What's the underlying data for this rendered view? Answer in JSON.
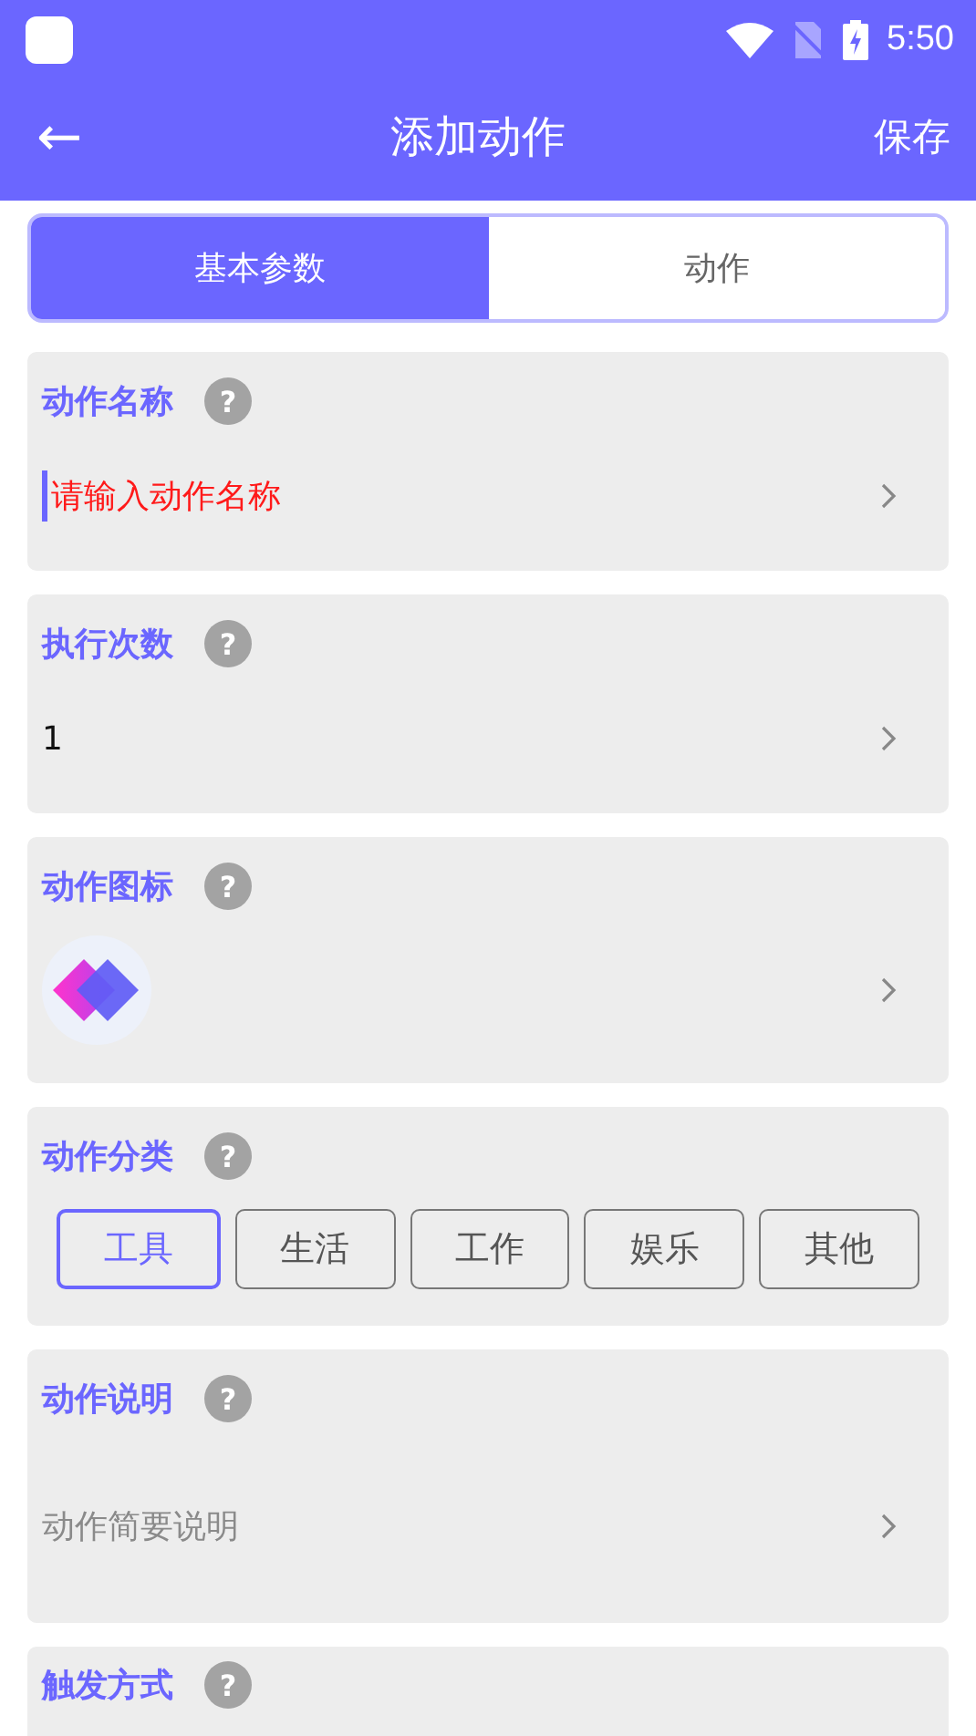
{
  "status_bar": {
    "time": "5:50"
  },
  "app_bar": {
    "back": "←",
    "title": "添加动作",
    "action": "保存"
  },
  "tabs": [
    {
      "label": "基本参数",
      "selected": true
    },
    {
      "label": "动作",
      "selected": false
    }
  ],
  "sections": [
    {
      "kind": "input",
      "title": "动作名称",
      "help": "?",
      "placeholder": "请输入动作名称",
      "focused": true
    },
    {
      "kind": "value",
      "title": "执行次数",
      "help": "?",
      "value": "1"
    },
    {
      "kind": "icon",
      "title": "动作图标",
      "help": "?"
    },
    {
      "kind": "chips",
      "title": "动作分类",
      "help": "?",
      "options": [
        {
          "label": "工具",
          "selected": true
        },
        {
          "label": "生活",
          "selected": false
        },
        {
          "label": "工作",
          "selected": false
        },
        {
          "label": "娱乐",
          "selected": false
        },
        {
          "label": "其他",
          "selected": false
        }
      ]
    },
    {
      "kind": "description",
      "title": "动作说明",
      "help": "?",
      "placeholder": "动作简要说明"
    },
    {
      "kind": "trigger",
      "title": "触发方式",
      "help": "?"
    }
  ]
}
